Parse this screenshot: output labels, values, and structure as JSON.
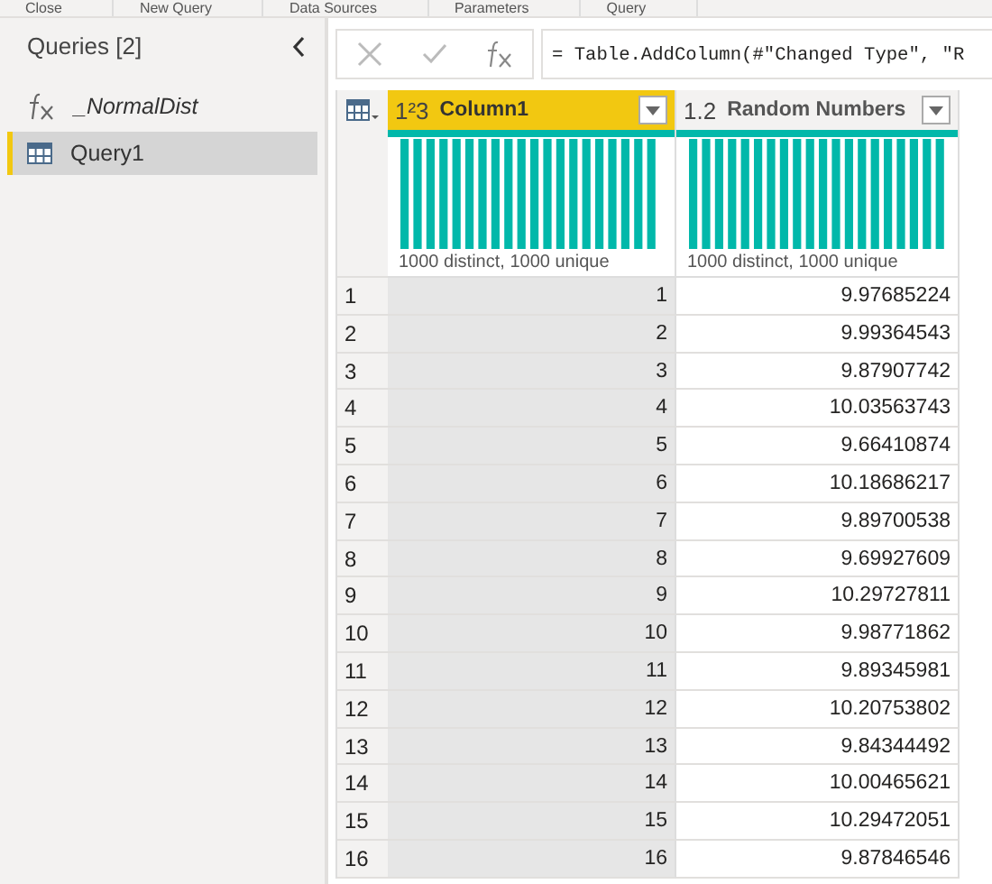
{
  "ribbon_groups": [
    "Close",
    "New Query",
    "Data Sources",
    "Parameters",
    "Query"
  ],
  "queries_pane": {
    "title": "Queries [2]",
    "items": [
      {
        "kind": "function",
        "label": "_NormalDist",
        "selected": false
      },
      {
        "kind": "table",
        "label": "Query1",
        "selected": true
      }
    ]
  },
  "formula_bar": {
    "formula": "= Table.AddColumn(#\"Changed Type\", \"R"
  },
  "table": {
    "columns": [
      {
        "type_label": "1²3",
        "name": "Column1",
        "selected": true,
        "profile": "1000 distinct, 1000 unique"
      },
      {
        "type_label": "1.2",
        "name": "Random Numbers",
        "selected": false,
        "profile": "1000 distinct, 1000 unique"
      }
    ],
    "rows": [
      [
        "1",
        "1",
        "9.97685224"
      ],
      [
        "2",
        "2",
        "9.99364543"
      ],
      [
        "3",
        "3",
        "9.87907742"
      ],
      [
        "4",
        "4",
        "10.03563743"
      ],
      [
        "5",
        "5",
        "9.66410874"
      ],
      [
        "6",
        "6",
        "10.18686217"
      ],
      [
        "7",
        "7",
        "9.89700538"
      ],
      [
        "8",
        "8",
        "9.69927609"
      ],
      [
        "9",
        "9",
        "10.29727811"
      ],
      [
        "10",
        "10",
        "9.98771862"
      ],
      [
        "11",
        "11",
        "9.89345981"
      ],
      [
        "12",
        "12",
        "10.20753802"
      ],
      [
        "13",
        "13",
        "9.84344492"
      ],
      [
        "14",
        "14",
        "10.00465621"
      ],
      [
        "15",
        "15",
        "10.29472051"
      ],
      [
        "16",
        "16",
        "9.87846546"
      ]
    ]
  }
}
